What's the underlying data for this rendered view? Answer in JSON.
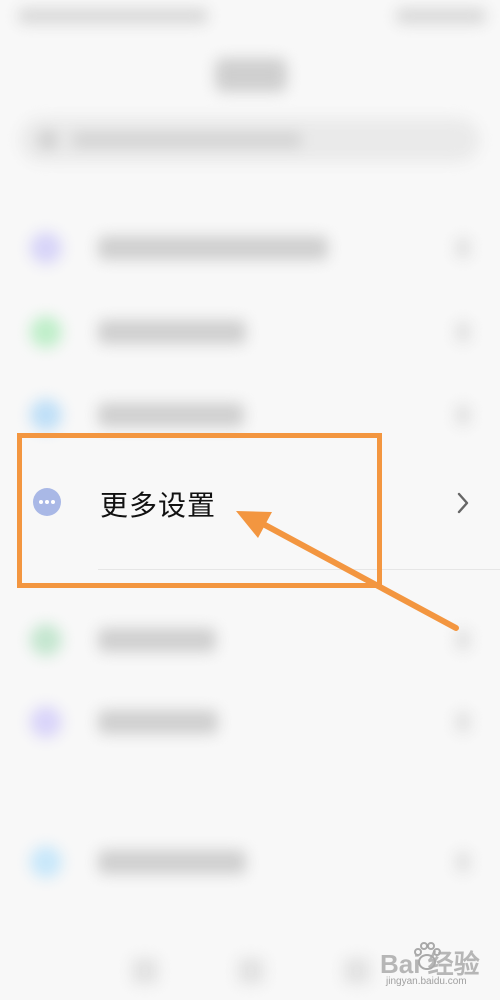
{
  "highlighted_item": {
    "label": "更多设置",
    "icon": "more-dots-icon",
    "icon_color": "#a9b8e6",
    "chevron_icon": "chevron-right-icon"
  },
  "annotation": {
    "box_color": "#f39640",
    "arrow_color": "#f39640"
  },
  "watermark": {
    "main": "Bai 经验",
    "sub": "jingyan.baidu.com"
  },
  "blurred_rows": [
    {
      "icon_color": "#d7d4f8"
    },
    {
      "icon_color": "#bfeec9"
    },
    {
      "icon_color": "#bfdff7"
    },
    {
      "icon_color": "#c4e6cf"
    },
    {
      "icon_color": "#d9d4f9"
    },
    {
      "icon_color": "#c8e7fa"
    }
  ]
}
